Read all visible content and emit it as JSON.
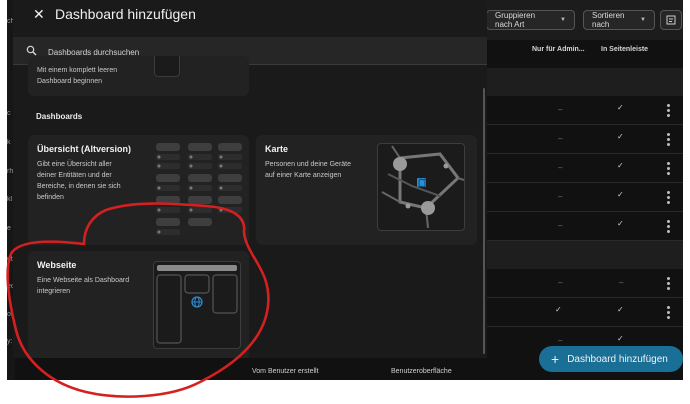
{
  "background": {
    "toolbar": {
      "group_by_label": "Gruppieren nach Art",
      "sort_label": "Sortieren nach"
    },
    "columns": {
      "admin_only": "Nur für Admin...",
      "in_sidebar": "In Seitenleiste"
    },
    "left_fragments": [
      "ch",
      "c",
      "k",
      "rh",
      "kl",
      "e",
      "ut",
      "ec",
      "ol",
      "y:"
    ],
    "row_dash": "–",
    "bottom_labels": {
      "created_by": "Vom Benutzer erstellt",
      "ui": "Benutzeroberfläche"
    },
    "fab": {
      "plus": "+",
      "label": "Dashboard hinzufügen"
    }
  },
  "dialog": {
    "title": "Dashboard hinzufügen",
    "close_glyph": "✕",
    "search_placeholder": "Dashboards durchsuchen",
    "partial_card_desc": "Mit einem komplett leeren\nDashboard beginnen",
    "section_heading": "Dashboards",
    "cards": {
      "legacy": {
        "title": "Übersicht (Altversion)",
        "desc": "Gibt eine Übersicht aller\ndeiner Entitäten und der\nBereiche, in denen sie sich\nbefinden"
      },
      "map": {
        "title": "Karte",
        "desc": "Personen und deine Geräte\nauf einer Karte anzeigen"
      },
      "webpage": {
        "title": "Webseite",
        "desc": "Eine Webseite als Dashboard\nintegrieren"
      }
    }
  },
  "colors": {
    "accent": "#1a6f96",
    "annotation": "#d42020",
    "map_pin": "#2a8fd6"
  },
  "icons": {
    "close": "close-icon",
    "search": "search-icon",
    "filter": "filter-icon",
    "check": "check-icon",
    "more": "more-vert-icon",
    "globe": "globe-icon",
    "map": "map-icon"
  }
}
